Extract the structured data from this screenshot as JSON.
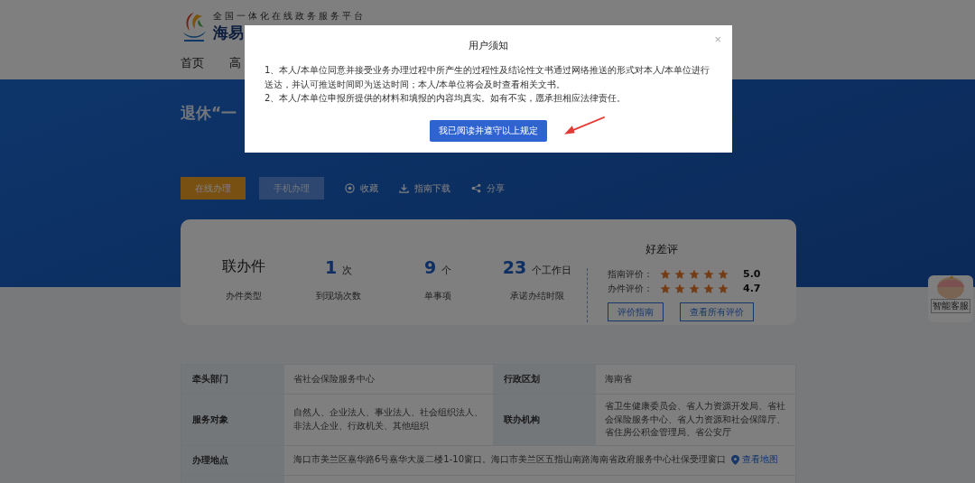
{
  "header": {
    "platform": "全国一体化在线政务服务平台",
    "brand": "海易",
    "nav": [
      {
        "label": "首页",
        "selected": false
      },
      {
        "label": "高",
        "selected": false
      }
    ]
  },
  "banner": {
    "title": "退休“一"
  },
  "actions": {
    "buttons": [
      {
        "label": "在线办理",
        "kind": "primary"
      },
      {
        "label": "手机办理",
        "kind": "secondary"
      }
    ],
    "links": [
      {
        "label": "收藏",
        "kind": "favorite"
      },
      {
        "label": "指南下载",
        "kind": "download"
      },
      {
        "label": "分享",
        "kind": "share"
      }
    ]
  },
  "summary": {
    "stats": [
      {
        "value": "联办件",
        "label": "办件类型",
        "kind": "text"
      },
      {
        "value": "1",
        "unit": "次",
        "label": "到现场次数",
        "kind": "number"
      },
      {
        "value": "9",
        "unit": "个",
        "label": "单事项",
        "kind": "number"
      },
      {
        "value": "23",
        "unit": "个工作日",
        "label": "承诺办结时限",
        "kind": "number"
      }
    ],
    "ratings": {
      "title": "好差评",
      "items": [
        {
          "label": "指南评价：",
          "stars": 5,
          "score": "5.0"
        },
        {
          "label": "办件评价：",
          "stars": 5,
          "score": "4.7"
        }
      ],
      "buttons": [
        "评价指南",
        "查看所有评价"
      ]
    }
  },
  "details": [
    {
      "label": "牵头部门",
      "value": "省社会保险服务中心",
      "label2": "行政区划",
      "value2": "海南省"
    },
    {
      "label": "服务对象",
      "value": "自然人、企业法人、事业法人、社会组织法人、非法人企业、行政机关、其他组织",
      "label2": "联办机构",
      "value2": "省卫生健康委员会、省人力资源开发局、省社会保险服务中心、省人力资源和社会保障厅、省住房公积金管理局、省公安厅"
    },
    {
      "label": "办理地点",
      "value": "海口市美兰区嘉华路6号嘉华大厦二楼1-10窗口。海口市美兰区五指山南路海南省政府服务中心社保受理窗口",
      "link": "查看地图"
    }
  ],
  "assistant": {
    "label": "智能客服"
  },
  "modal": {
    "title": "用户须知",
    "close": "×",
    "paragraphs": [
      "1、本人/本单位同意并接受业务办理过程中所产生的过程性及结论性文书通过网络推送的形式对本人/本单位进行送达，并认可推送时间即为送达时间；本人/本单位将会及时查看相关文书。",
      "2、本人/本单位申报所提供的材料和填报的内容均真实。如有不实，愿承担相应法律责任。"
    ],
    "confirm": "我已阅读并遵守以上规定"
  }
}
